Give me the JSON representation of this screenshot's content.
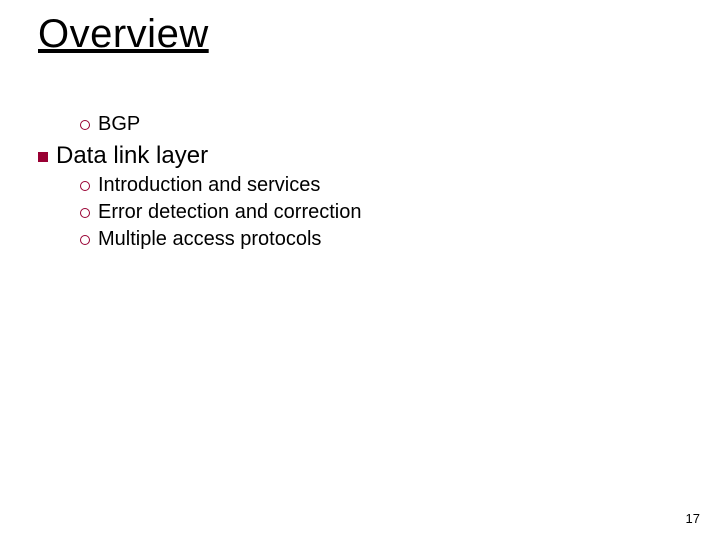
{
  "title": "Overview",
  "sub_items_top": [
    "BGP"
  ],
  "section": {
    "heading": "Data link layer",
    "items": [
      "Introduction and services",
      "Error detection and correction",
      "Multiple access protocols"
    ]
  },
  "page_number": "17"
}
